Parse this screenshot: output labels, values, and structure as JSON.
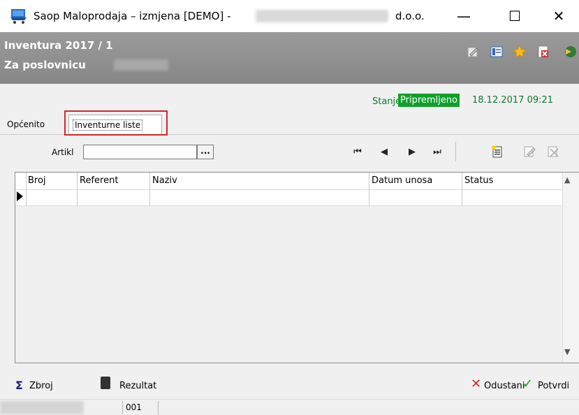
{
  "window": {
    "title": "Saop Maloprodaja – izmjena  [DEMO] -",
    "title_suffix": "d.o.o.",
    "min_glyph": "—",
    "max_glyph": "☐",
    "close_glyph": "✕"
  },
  "header": {
    "title": "Inventura 2017 / 1",
    "subtitle": "Za poslovnicu"
  },
  "status": {
    "label": "Stanje:",
    "value": "Pripremljeno",
    "datetime": "18.12.2017 09:21"
  },
  "tabs": [
    {
      "label": "Općenito",
      "active": false
    },
    {
      "label": "Inventurne liste",
      "active": true
    }
  ],
  "toolbar": {
    "artikl_label": "Artikl",
    "artikl_value": "",
    "browse_label": "...",
    "nav": [
      "⏮",
      "◀",
      "▶",
      "⏭"
    ]
  },
  "grid": {
    "columns": [
      "Broj",
      "Referent",
      "Naziv",
      "Datum unosa",
      "Status"
    ],
    "rows": [
      [
        "",
        "",
        "",
        "",
        ""
      ]
    ]
  },
  "footer": {
    "zbroj_label": "Zbroj",
    "rezultat_label": "Rezultat",
    "odustani_label": "Odustani",
    "potvrdi_label": "Potvrdi"
  },
  "statusbar": {
    "code": "001"
  },
  "colors": {
    "header_bg": "#8f8f8f",
    "status_green": "#0fa02a",
    "highlight_red": "#d0262c"
  }
}
